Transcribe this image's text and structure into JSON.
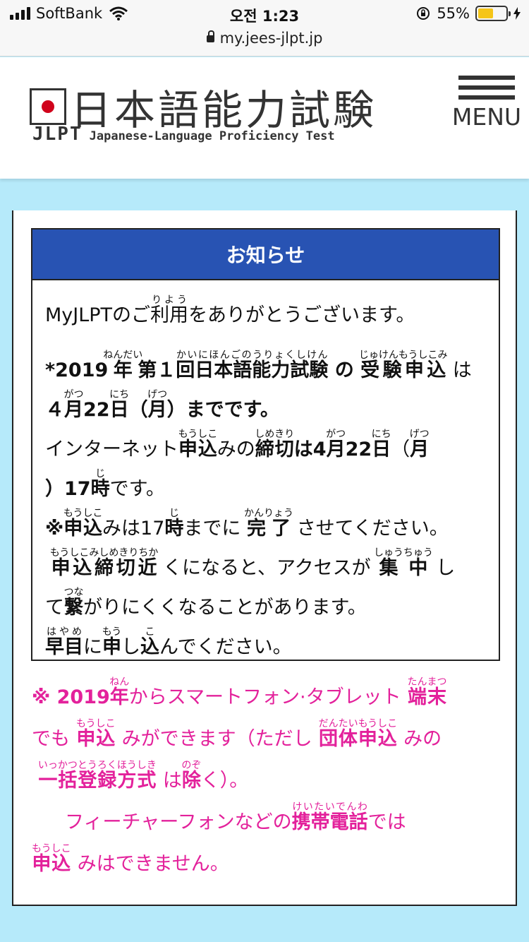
{
  "status_bar": {
    "carrier": "SoftBank",
    "time": "오전 1:23",
    "battery": "55%",
    "battery_level": 0.55,
    "url": "my.jees-jlpt.jp"
  },
  "header": {
    "logo_title": "日本語能力試験",
    "logo_abbr": "JLPT",
    "logo_subtitle": "Japanese-Language Proficiency Test",
    "menu_label": "MENU"
  },
  "notice": {
    "title": "お知らせ",
    "l1a": "MyJLPTのご",
    "l1_riyo": "利用",
    "l1_riyo_rt": "りよう",
    "l1b": "をありがとうございます。",
    "l2_a": "*2019",
    "l2_nen": "年",
    "l2_nen_rt": "ねんだい",
    "l2_b": "第１",
    "l2_kai": "回日本語能力試験",
    "l2_kai_rt": "かいにほんごのうりょくしけん",
    "l2_c": "の",
    "l2_jm": "受験申込",
    "l2_jm_rt": "じゅけんもうしこみ",
    "l2_d": "は",
    "l3_a": "４",
    "l3_gatsu": "月",
    "l3_gatsu_rt": "がつ",
    "l3_b": "22",
    "l3_nichi": "日",
    "l3_nichi_rt": "にち",
    "l3_c": "（",
    "l3_getsu": "月",
    "l3_getsu_rt": "げつ",
    "l3_d": "）までです。",
    "l4_a": "インターネット",
    "l4_mk": "申込",
    "l4_mk_rt": "もうしこ",
    "l4_b": "みの",
    "l4_sk": "締切",
    "l4_sk_rt": "しめきり",
    "l4_c": "は4",
    "l4_gatsu": "月",
    "l4_gatsu_rt": "がつ",
    "l4_d": "22",
    "l4_nichi": "日",
    "l4_nichi_rt": "にち",
    "l4_e": "（",
    "l4_getsu": "月",
    "l4_getsu_rt": "げつ",
    "l5_a": "）17",
    "l5_ji": "時",
    "l5_ji_rt": "じ",
    "l5_b": "です。",
    "l6_a": "※",
    "l6_mk": "申込",
    "l6_mk_rt": "もうしこ",
    "l6_b": "みは17",
    "l6_ji": "時",
    "l6_ji_rt": "じ",
    "l6_c": "までに",
    "l6_kr": "完了",
    "l6_kr_rt": "かんりょう",
    "l6_d": "させてください。",
    "l7_mk": "申込締切近",
    "l7_mk_rt": "もうしこみしめきりちか",
    "l7_a": "くになると、アクセスが",
    "l7_sc": "集中",
    "l7_sc_rt": "しゅうちゅう",
    "l7_b": "し",
    "l8_a": "て",
    "l8_tsu": "繋",
    "l8_tsu_rt": "つな",
    "l8_b": "がりにくくなることがあります。",
    "l9_hy": "早目",
    "l9_hy_rt": "はやめ",
    "l9_a": "に",
    "l9_mo": "申",
    "l9_mo_rt": "もう",
    "l9_b": "し",
    "l9_ko": "込",
    "l9_ko_rt": "こ",
    "l9_c": "んでください。"
  },
  "pink_note": {
    "p1_a": "※ 2019",
    "p1_nen": "年",
    "p1_nen_rt": "ねん",
    "p1_b": "からスマートフォン·タブレット",
    "p1_tm": "端末",
    "p1_tm_rt": "たんまつ",
    "p2_a": "でも",
    "p2_mk": "申込",
    "p2_mk_rt": "もうしこ",
    "p2_b": "みができます（ただし",
    "p2_dt": "団体申込",
    "p2_dt_rt": "だんたいもうしこ",
    "p2_c": "みの",
    "p3_ik": "一括登録方式",
    "p3_ik_rt": "いっかつとうろくほうしき",
    "p3_a": "は",
    "p3_no": "除",
    "p3_no_rt": "のぞ",
    "p3_b": "く）。",
    "p4_a": "フィーチャーフォンなどの",
    "p4_kd": "携帯電話",
    "p4_kd_rt": "けいたいでんわ",
    "p4_b": "では",
    "p5_mk": "申込",
    "p5_mk_rt": "もうしこ",
    "p5_a": "みはできません。"
  }
}
